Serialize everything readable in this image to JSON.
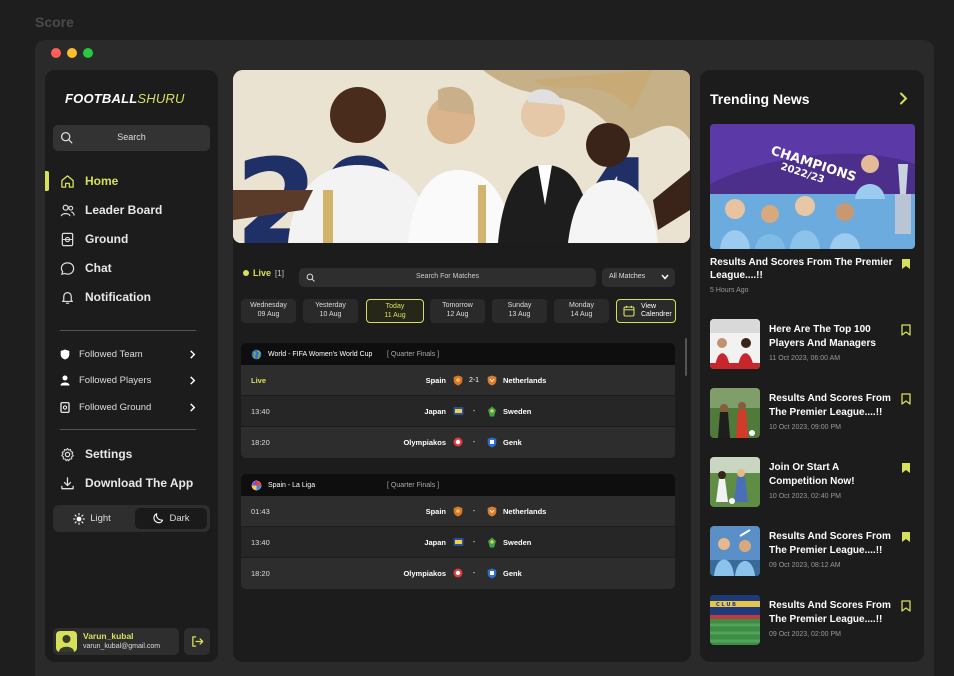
{
  "page_label": "Score",
  "logo": {
    "part1": "FOOTBALL",
    "part2": "SHURU"
  },
  "sidebar": {
    "search_label": "Search",
    "nav": [
      {
        "label": "Home",
        "icon": "home-icon"
      },
      {
        "label": "Leader Board",
        "icon": "users-icon"
      },
      {
        "label": "Ground",
        "icon": "ground-icon"
      },
      {
        "label": "Chat",
        "icon": "chat-icon"
      },
      {
        "label": "Notification",
        "icon": "bell-icon"
      }
    ],
    "followed": [
      {
        "label": "Followed Team",
        "icon": "shield-icon"
      },
      {
        "label": "Followed Players",
        "icon": "person-icon"
      },
      {
        "label": "Followed Ground",
        "icon": "ground-icon"
      }
    ],
    "settings_label": "Settings",
    "download_label": "Download The App",
    "theme": {
      "light": "Light",
      "dark": "Dark"
    },
    "user": {
      "name": "Varun_kubal",
      "email": "varun_kubal@gmail.com"
    }
  },
  "matches": {
    "live_label": "Live",
    "live_count": "[1]",
    "search_placeholder": "Search For Matches",
    "filter_value": "All Matches",
    "dates": [
      {
        "day": "Wednesday",
        "date": "09 Aug",
        "active": false
      },
      {
        "day": "Yesterday",
        "date": "10 Aug",
        "active": false
      },
      {
        "day": "Today",
        "date": "11 Aug",
        "active": true
      },
      {
        "day": "Tomorrow",
        "date": "12 Aug",
        "active": false
      },
      {
        "day": "Sunday",
        "date": "13 Aug",
        "active": false
      },
      {
        "day": "Monday",
        "date": "14 Aug",
        "active": false
      }
    ],
    "calendar_label": {
      "line1": "View",
      "line2": "Calendrer"
    },
    "competitions": [
      {
        "name": "World - FIFA Women's World Cup",
        "round": "[ Quarter Finals ]",
        "rows": [
          {
            "time": "Live",
            "home": "Spain",
            "score": "2-1",
            "away": "Netherlands"
          },
          {
            "time": "13:40",
            "home": "Japan",
            "score": "-",
            "away": "Sweden"
          },
          {
            "time": "18:20",
            "home": "Olympiakos",
            "score": "-",
            "away": "Genk"
          }
        ]
      },
      {
        "name": "Spain - La Liga",
        "round": "[ Quarter Finals ]",
        "rows": [
          {
            "time": "01:43",
            "home": "Spain",
            "score": "-",
            "away": "Netherlands"
          },
          {
            "time": "13:40",
            "home": "Japan",
            "score": "-",
            "away": "Sweden"
          },
          {
            "time": "18:20",
            "home": "Olympiakos",
            "score": "-",
            "away": "Genk"
          }
        ]
      }
    ]
  },
  "trending": {
    "title": "Trending News",
    "feature": {
      "title": "Results And Scores From The Premier League....!!",
      "time": "5 Hours Ago"
    },
    "items": [
      {
        "title": "Here Are The Top 100 Players And Managers",
        "time": "11 Oct 2023, 06:00 AM",
        "saved": false
      },
      {
        "title": "Results And Scores From The Premier League....!!",
        "time": "10 Oct 2023, 09:00 PM",
        "saved": false
      },
      {
        "title": "Join Or Start A Competition Now!",
        "time": "10 Oct 2023, 02:40 PM",
        "saved": true
      },
      {
        "title": "Results And Scores From The Premier League....!!",
        "time": "09 Oct 2023, 08:12 AM",
        "saved": true
      },
      {
        "title": "Results And Scores From The Premier League....!!",
        "time": "09 Oct 2023, 02:00 PM",
        "saved": false
      }
    ]
  },
  "colors": {
    "accent": "#d7e05a",
    "bg": "#1e1e1e",
    "panel": "#1c1c1c"
  }
}
